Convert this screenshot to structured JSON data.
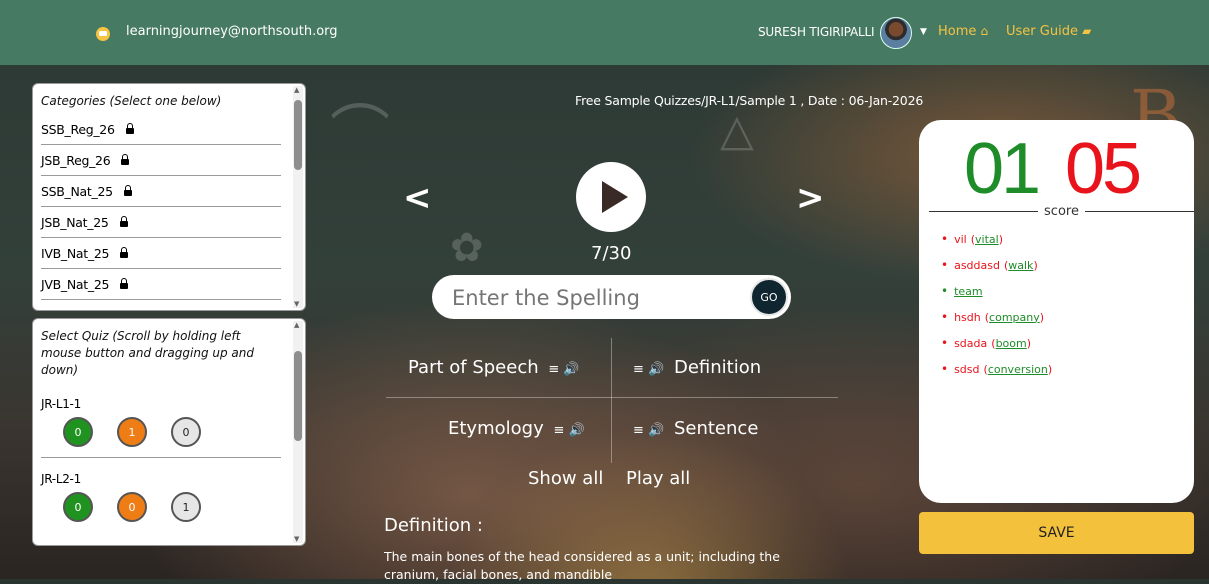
{
  "topbar": {
    "email": "learningjourney@northsouth.org",
    "user_name": "SURESH TIGIRIPALLI",
    "home_label": "Home",
    "guide_label": "User Guide"
  },
  "categories": {
    "heading": "Categories (Select one below)",
    "items": [
      "SSB_Reg_26",
      "JSB_Reg_26",
      "SSB_Nat_25",
      "JSB_Nat_25",
      "IVB_Nat_25",
      "JVB_Nat_25"
    ]
  },
  "quizzes": {
    "heading": "Select Quiz (Scroll by holding left mouse button and dragging up and down)",
    "items": [
      {
        "name": "JR-L1-1",
        "correct": "0",
        "wrong": "1",
        "remaining": "0"
      },
      {
        "name": "JR-L2-1",
        "correct": "0",
        "wrong": "0",
        "remaining": "1"
      }
    ]
  },
  "quiz": {
    "title": "Free Sample Quizzes/JR-L1/Sample 1 , Date : 06-Jan-2026",
    "progress": "7/30",
    "input_placeholder": "Enter the Spelling",
    "go_label": "GO",
    "hints": {
      "part_of_speech": "Part of Speech",
      "definition": "Definition",
      "etymology": "Etymology",
      "sentence": "Sentence"
    },
    "show_all": "Show all",
    "play_all": "Play all",
    "definition_heading": "Definition :",
    "definition_text": "The main bones of the head considered as a unit; including the cranium, facial bones, and mandible"
  },
  "score": {
    "correct": "01",
    "wrong": "05",
    "label": "score",
    "words": [
      {
        "typed": "vil",
        "correct": "vital",
        "ok": false
      },
      {
        "typed": "asddasd",
        "correct": "walk",
        "ok": false
      },
      {
        "typed": "",
        "correct": "team",
        "ok": true
      },
      {
        "typed": "hsdh",
        "correct": "company",
        "ok": false
      },
      {
        "typed": "sdada",
        "correct": "boom",
        "ok": false
      },
      {
        "typed": "sdsd",
        "correct": "conversion",
        "ok": false
      }
    ],
    "save_label": "SAVE"
  },
  "colors": {
    "topbar": "#477a62",
    "accent_yellow": "#f3c13b",
    "correct_green": "#1f8c2a",
    "wrong_red": "#e8131b"
  }
}
